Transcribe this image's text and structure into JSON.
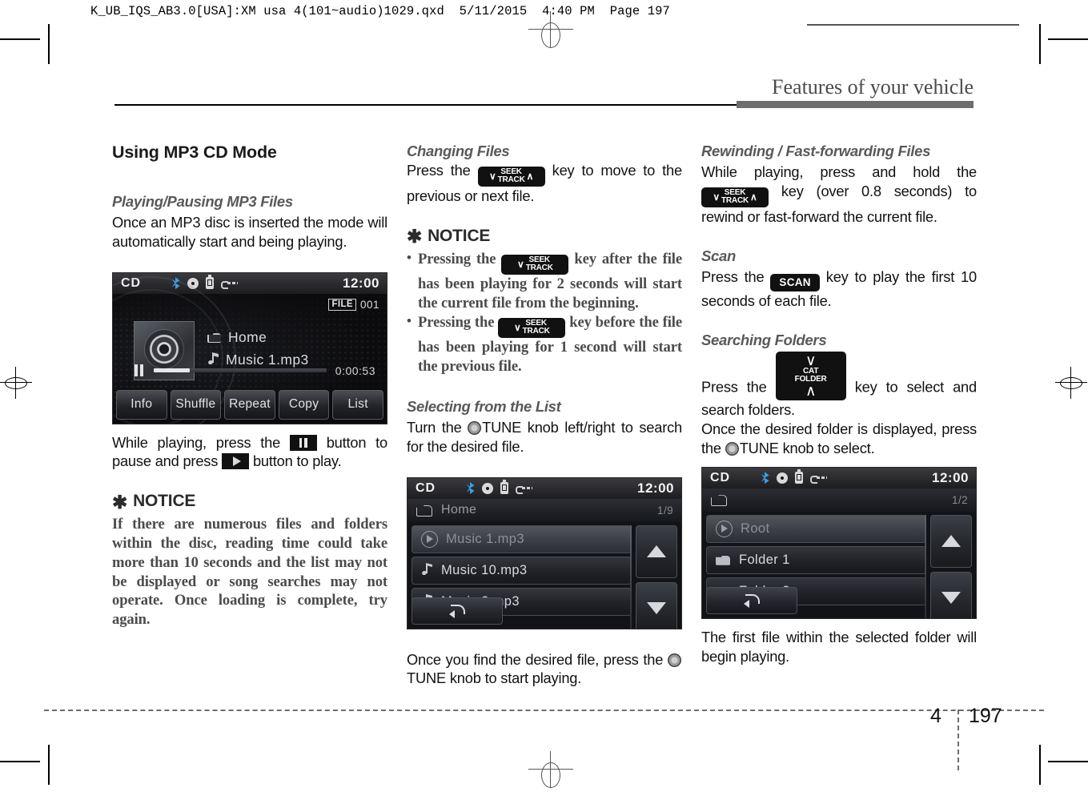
{
  "print_header": {
    "text": "K_UB_IQS_AB3.0[USA]:XM usa 4(101~audio)1029.qxd  5/11/2015  4:40 PM  Page 197"
  },
  "running_head": {
    "title": "Features of your vehicle"
  },
  "footer": {
    "chapter": "4",
    "page": "197"
  },
  "col1": {
    "title": "Using MP3 CD Mode",
    "section1": {
      "heading": "Playing/Pausing MP3 Files",
      "body": "Once an MP3 disc is inserted the mode will automatically start and being playing."
    },
    "pause_text_1": "While playing, press the",
    "pause_text_2": "button to pause and press",
    "pause_text_3": "button to play.",
    "notice": {
      "star": "✱",
      "heading": "NOTICE",
      "body": "If there are numerous files and folders within the disc, reading time could take more than 10 seconds and the list may not be displayed or song searches may not operate. Once loading is complete, try again."
    },
    "screen": {
      "source": "CD",
      "time": "12:00",
      "file_label": "FILE",
      "file_number": "001",
      "folder": "Home",
      "track": "Music 1.mp3",
      "elapsed": "0:00:53",
      "progress_percent": 21,
      "buttons": [
        "Info",
        "Shuffle",
        "Repeat",
        "Copy",
        "List"
      ],
      "icons": [
        "bluetooth-icon",
        "disc-icon",
        "usb-device-icon",
        "aux-cable-icon"
      ]
    }
  },
  "col2": {
    "section1": {
      "heading": "Changing Files",
      "text_before": "Press the",
      "text_after": "key to move to the previous or next file."
    },
    "notice": {
      "star": "✱",
      "heading": "NOTICE",
      "items": [
        {
          "before": "Pressing the",
          "after": "key after the file has been playing for 2 seconds will start the current file from the beginning."
        },
        {
          "before": "Pressing the",
          "after": "key before the file has been playing for 1 second will start the previous file."
        }
      ]
    },
    "section2": {
      "heading": "Selecting from the List",
      "text_before": "Turn the",
      "text_after": "TUNE knob left/right to search for the desired file."
    },
    "after_screen": {
      "text_before": "Once you find the desired file, press the",
      "text_after": "TUNE knob to start playing."
    },
    "screen": {
      "source": "CD",
      "time": "12:00",
      "folder": "Home",
      "page_indicator": "1/9",
      "rows": [
        {
          "icon": "play-icon",
          "label": "Music 1.mp3",
          "selected": true
        },
        {
          "icon": "music-note-icon",
          "label": "Music 10.mp3",
          "selected": false
        },
        {
          "icon": "music-note-icon",
          "label": "Music 2.mp3",
          "selected": false
        }
      ]
    }
  },
  "col3": {
    "section1": {
      "heading": "Rewinding / Fast-forwarding Files",
      "text_before": "While playing, press and hold the",
      "text_after": "key (over 0.8 seconds) to rewind or fast-forward the current file."
    },
    "section2": {
      "heading": "Scan",
      "text_before": "Press the",
      "text_after": "key to play the first 10 seconds of each file."
    },
    "section3": {
      "heading": "Searching Folders",
      "text_before": "Press the",
      "text_after": "key to select and search folders.",
      "para2_before": "Once the desired folder is displayed, press the",
      "para2_after": "TUNE knob to select."
    },
    "after_screen": "The first file within the selected folder will begin playing.",
    "screen": {
      "source": "CD",
      "time": "12:00",
      "folder": "",
      "page_indicator": "1/2",
      "rows": [
        {
          "icon": "play-icon",
          "label": "Root",
          "selected": true
        },
        {
          "icon": "folder-icon",
          "label": "Folder 1",
          "selected": false
        },
        {
          "icon": "folder-icon",
          "label": "Folder 2",
          "selected": false
        }
      ]
    }
  },
  "keys": {
    "seek": {
      "line1": "SEEK",
      "line2": "TRACK",
      "chev_down": "∨",
      "chev_up": "∧"
    },
    "scan": {
      "label": "SCAN"
    },
    "cat_folder": {
      "line1": "CAT",
      "line2": "FOLDER",
      "chev_down": "∨",
      "chev_up": "∧"
    }
  },
  "colors": {
    "key_black": "#111111",
    "heading_gray": "#595959",
    "rule_gray": "#6d6d6d",
    "bluetooth_blue": "#3aa0e8"
  }
}
